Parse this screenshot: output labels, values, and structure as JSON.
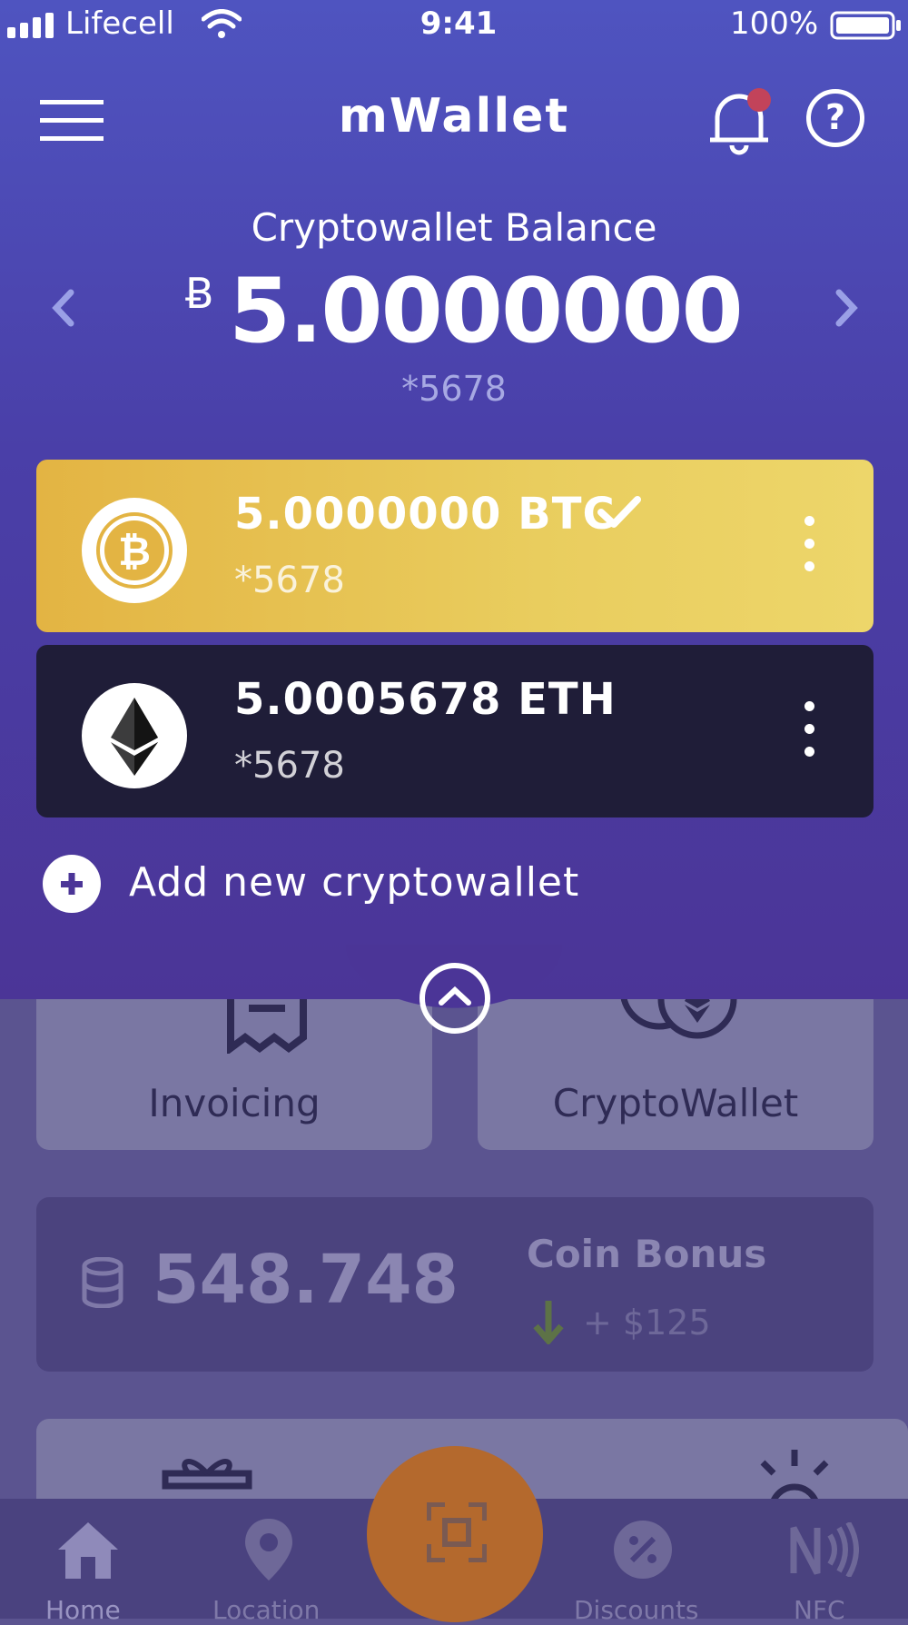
{
  "status_bar": {
    "carrier": "Lifecell",
    "time": "9:41",
    "battery": "100%"
  },
  "header": {
    "title": "mWallet"
  },
  "balance": {
    "label": "Cryptowallet Balance",
    "currency_symbol": "Ƀ",
    "amount": "5.0000000",
    "account": "*5678"
  },
  "wallets": [
    {
      "amount": "5.0000000 BTC",
      "account": "*5678",
      "selected": true
    },
    {
      "amount": "5.0005678 ETH",
      "account": "*5678",
      "selected": false
    }
  ],
  "add_wallet": {
    "label": "Add new cryptowallet"
  },
  "tiles": {
    "invoicing": "Invoicing",
    "cryptowallet": "CryptoWallet"
  },
  "coin_bonus": {
    "value": "548.748",
    "label": "Coin Bonus",
    "delta": "+ $125"
  },
  "bottom_nav": {
    "home": "Home",
    "location": "Location",
    "discounts": "Discounts",
    "nfc": "NFC"
  },
  "colors": {
    "btc": "#e6c24f",
    "eth": "#1f1d38",
    "scan": "#b4692d"
  }
}
